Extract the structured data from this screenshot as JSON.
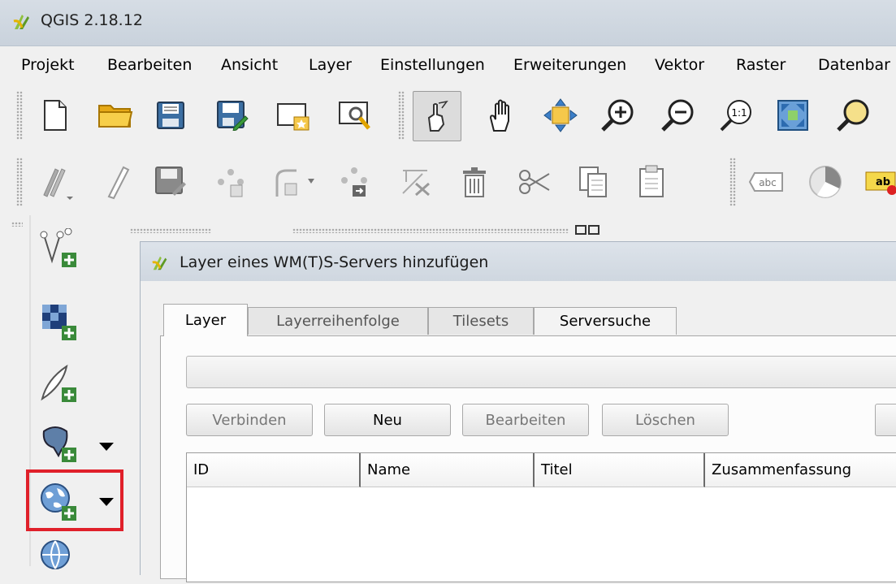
{
  "window": {
    "title": "QGIS 2.18.12"
  },
  "menu": [
    "Projekt",
    "Bearbeiten",
    "Ansicht",
    "Layer",
    "Einstellungen",
    "Erweiterungen",
    "Vektor",
    "Raster",
    "Datenbar"
  ],
  "toolbar1": {
    "icons": [
      "new-project-icon",
      "open-folder-icon",
      "save-icon",
      "save-as-icon",
      "new-print-composer-icon",
      "composer-manager-icon",
      "pan-to-selection-icon",
      "pan-hand-icon",
      "pan-map-icon",
      "zoom-in-icon",
      "zoom-out-icon",
      "zoom-native-icon",
      "zoom-full-icon",
      "zoom-layer-icon"
    ]
  },
  "toolbar2": {
    "icons": [
      "current-edits-icon",
      "toggle-editing-icon",
      "save-edits-icon",
      "add-feature-icon",
      "move-feature-icon",
      "node-tool-icon",
      "delete-selected-icon",
      "cut-features-icon",
      "copy-features-icon",
      "paste-features-icon",
      "label-icon",
      "diagram-icon",
      "label-pin-icon"
    ],
    "label_icon_text": "abc",
    "pin_text": "ab"
  },
  "left_panel": {
    "icons": [
      "add-vector-layer-icon",
      "add-raster-layer-icon",
      "add-delimited-text-icon",
      "add-postgis-layer-icon",
      "add-wms-layer-icon",
      "add-wcs-layer-icon"
    ]
  },
  "dialog": {
    "title": "Layer eines WM(T)S-Servers hinzufügen",
    "tabs": [
      "Layer",
      "Layerreihenfolge",
      "Tilesets",
      "Serversuche"
    ],
    "buttons": [
      "Verbinden",
      "Neu",
      "Bearbeiten",
      "Löschen"
    ],
    "columns": [
      "ID",
      "Name",
      "Titel",
      "Zusammenfassung"
    ]
  },
  "colors": {
    "highlight": "#e0202a",
    "qgis_green": "#6aa52a",
    "folder_yellow": "#f4c430"
  }
}
